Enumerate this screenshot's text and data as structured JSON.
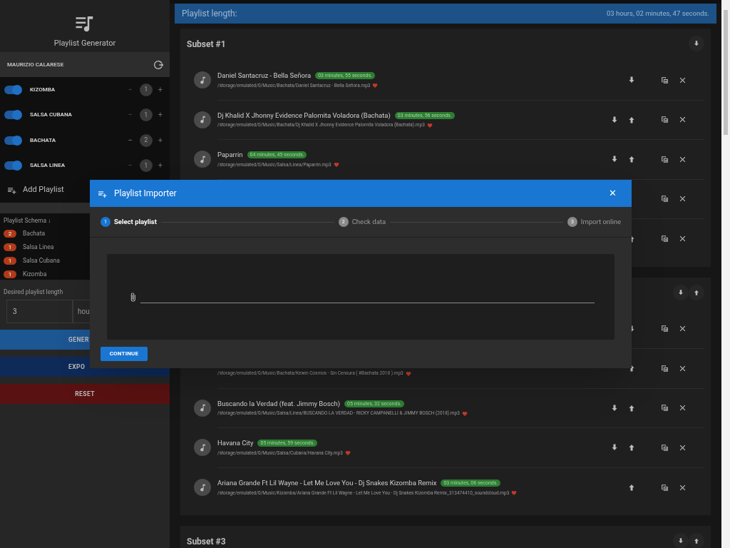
{
  "sidebar": {
    "app_title": "Playlist Generator",
    "user": "MAURIZIO CALARESE",
    "playlists": [
      {
        "name": "KIZOMBA",
        "on": true,
        "count": "1",
        "minus_disabled": true,
        "minus": "−",
        "plus": "+"
      },
      {
        "name": "SALSA CUBANA",
        "on": true,
        "count": "1",
        "minus_disabled": true,
        "minus": "−",
        "plus": "+"
      },
      {
        "name": "BACHATA",
        "on": true,
        "count": "2",
        "minus_disabled": false,
        "minus": "−",
        "plus": "+"
      },
      {
        "name": "SALSA LINEA",
        "on": true,
        "count": "1",
        "minus_disabled": true,
        "minus": "−",
        "plus": "+"
      }
    ],
    "add_playlist": "Add Playlist",
    "schema": {
      "title": "Playlist Schema ↓",
      "items": [
        {
          "count": "2",
          "name": "Bachata"
        },
        {
          "count": "1",
          "name": "Salsa Linea"
        },
        {
          "count": "1",
          "name": "Salsa Cubana"
        },
        {
          "count": "1",
          "name": "Kizomba"
        }
      ]
    },
    "length": {
      "label": "Desired playlist length",
      "value": "3",
      "unit": "hou"
    },
    "buttons": [
      {
        "label": "GENER",
        "kind": "generate"
      },
      {
        "label": "EXPO",
        "kind": "export"
      },
      {
        "label": "RESET",
        "kind": "reset"
      }
    ]
  },
  "main": {
    "length_label": "Playlist length:",
    "length_value": "03 hours, 02 minutes, 47 seconds.",
    "subsets": [
      {
        "title": "Subset #1",
        "move_down": true,
        "move_up": false,
        "songs": [
          {
            "title": "Daniel Santacruz - Bella Señora",
            "duration": "03 minutes, 55 seconds.",
            "path": "/storage/emulated/0/Music/Bachata/Daniel Santacruz - Bella Señora.mp3",
            "favorite": true,
            "move_down": true,
            "move_up": false
          },
          {
            "title": "Dj Khalid X Jhonny Evidence Palomita Voladora (Bachata)",
            "duration": "03 minutes, 56 seconds.",
            "path": "/storage/emulated/0/Music/Bachata/Dj Khalid X Jhonny Evidence Palomita Voladora (Bachata).mp3",
            "favorite": true,
            "move_down": true,
            "move_up": true
          },
          {
            "title": "Paparrin",
            "duration": "04 minutes, 45 seconds.",
            "path": "/storage/emulated/0/Music/Salsa/Linea/Paparrin.mp3",
            "favorite": true,
            "move_down": true,
            "move_up": true
          },
          {
            "move_down": false,
            "move_up": false
          },
          {
            "move_down": false,
            "move_up": true
          }
        ]
      },
      {
        "move_down": true,
        "move_up": true,
        "songs": [
          {
            "move_down": true,
            "move_up": false
          },
          {
            "path": "/storage/emulated/0/Music/Bachata/Kewin Cosmos - Sin Censura ( #Bachata 2018 ).mp3",
            "favorite": true,
            "move_down": false,
            "move_up": true
          },
          {
            "title": "Buscando la Verdad (feat. Jimmy Bosch)",
            "duration": "05 minutes, 32 seconds.",
            "path": "/storage/emulated/0/Music/Salsa/Linea/BUSCANDO LA VERDAD - RICKY CAMPANELLI & JIMMY BOSCH (2018).mp3",
            "favorite": true,
            "move_down": true,
            "move_up": true
          },
          {
            "title": "Havana City",
            "duration": "05 minutes, 59 seconds.",
            "path": "/storage/emulated/0/Music/Salsa/Cubana/Havana City.mp3",
            "favorite": true,
            "move_down": true,
            "move_up": true
          },
          {
            "title": "Ariana Grande Ft Lil Wayne - Let Me Love You - Dj Snakes Kizomba Remix",
            "duration": "03 minutes, 06 seconds.",
            "path": "/storage/emulated/0/Music/Kizomba/Ariana Grande Ft Lil Wayne - Let Me Love You - Dj Snakes Kizomba Remix_313474410_soundcloud.mp3",
            "favorite": true,
            "move_down": false,
            "move_up": true
          }
        ]
      },
      {
        "title": "Subset #3",
        "move_down": true,
        "move_up": true
      }
    ]
  },
  "dialog": {
    "title": "Playlist Importer",
    "close": "✕",
    "steps": [
      {
        "number": "1",
        "label": "Select playlist",
        "selected": true
      },
      {
        "number": "2",
        "label": "Check data",
        "selected": false
      },
      {
        "number": "3",
        "label": "Import online",
        "selected": false
      }
    ],
    "continue": "CONTINUE"
  }
}
